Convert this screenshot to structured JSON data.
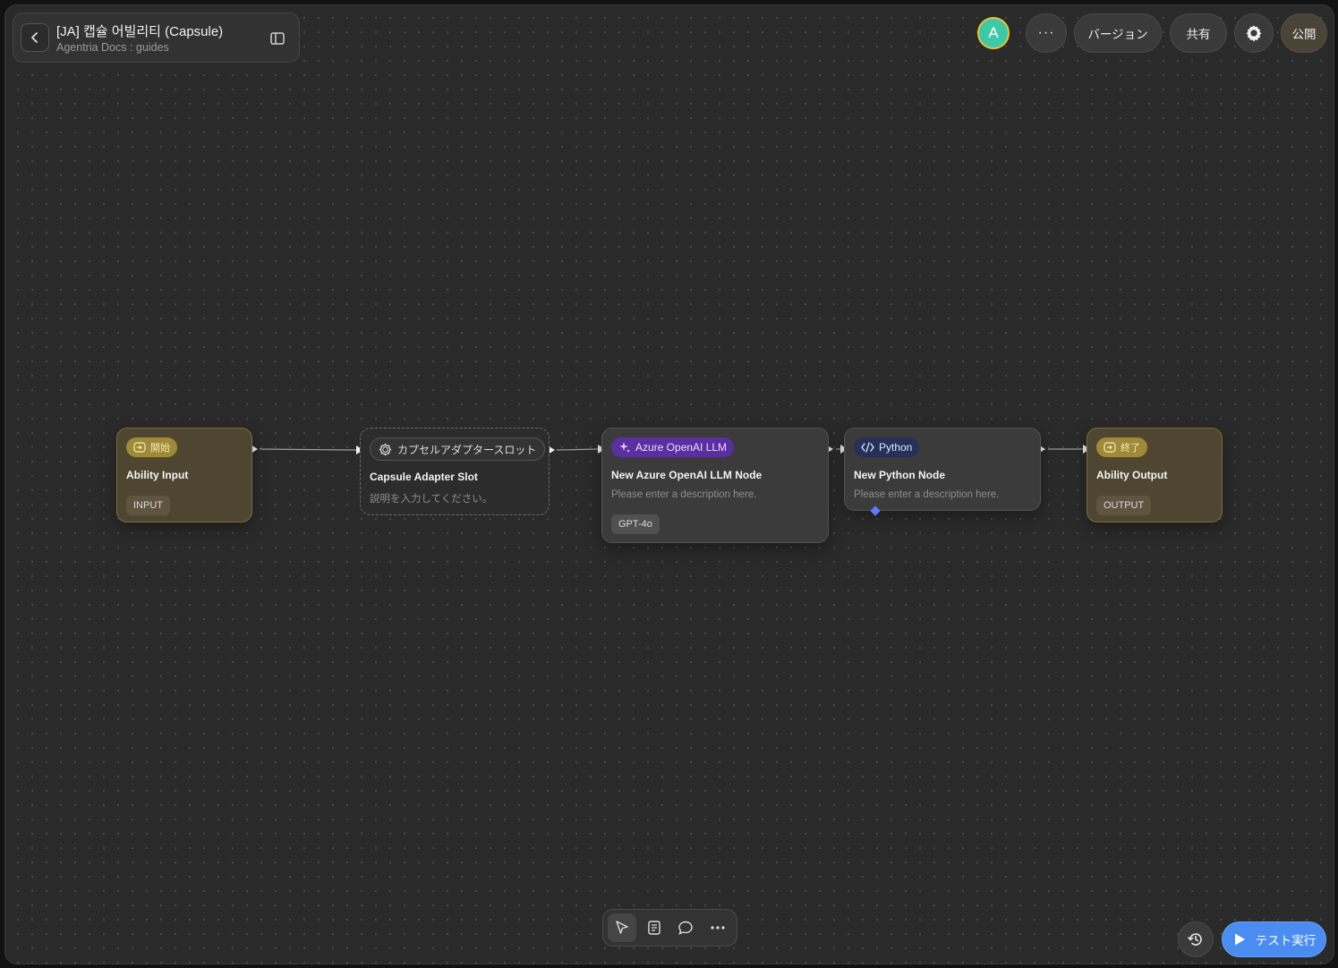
{
  "header": {
    "title": "[JA] 캡슐 어빌리티 (Capsule)",
    "subtitle": "Agentria Docs : guides"
  },
  "topbar": {
    "avatar_letter": "A",
    "more_label": "···",
    "version_label": "バージョン",
    "share_label": "共有",
    "publish_label": "公開"
  },
  "nodes": {
    "start": {
      "tag": "開始",
      "title": "Ability Input",
      "chip": "INPUT"
    },
    "slot": {
      "tag": "カプセルアダプタースロット",
      "title": "Capsule Adapter Slot",
      "description": "説明を入力してください。"
    },
    "llm": {
      "tag": "Azure OpenAI LLM",
      "title": "New Azure OpenAI LLM Node",
      "description": "Please enter a description here.",
      "model": "GPT-4o"
    },
    "python": {
      "tag": "Python",
      "title": "New Python Node",
      "description": "Please enter a description here."
    },
    "end": {
      "tag": "終了",
      "title": "Ability Output",
      "chip": "OUTPUT"
    }
  },
  "actions": {
    "run_label": "テスト実行"
  },
  "colors": {
    "canvas": "#2a2a2a",
    "io_node": "#4f4632",
    "llm_tag": "#5b2fa0",
    "python_tag": "#27305a",
    "run_button": "#4a8cf0"
  }
}
